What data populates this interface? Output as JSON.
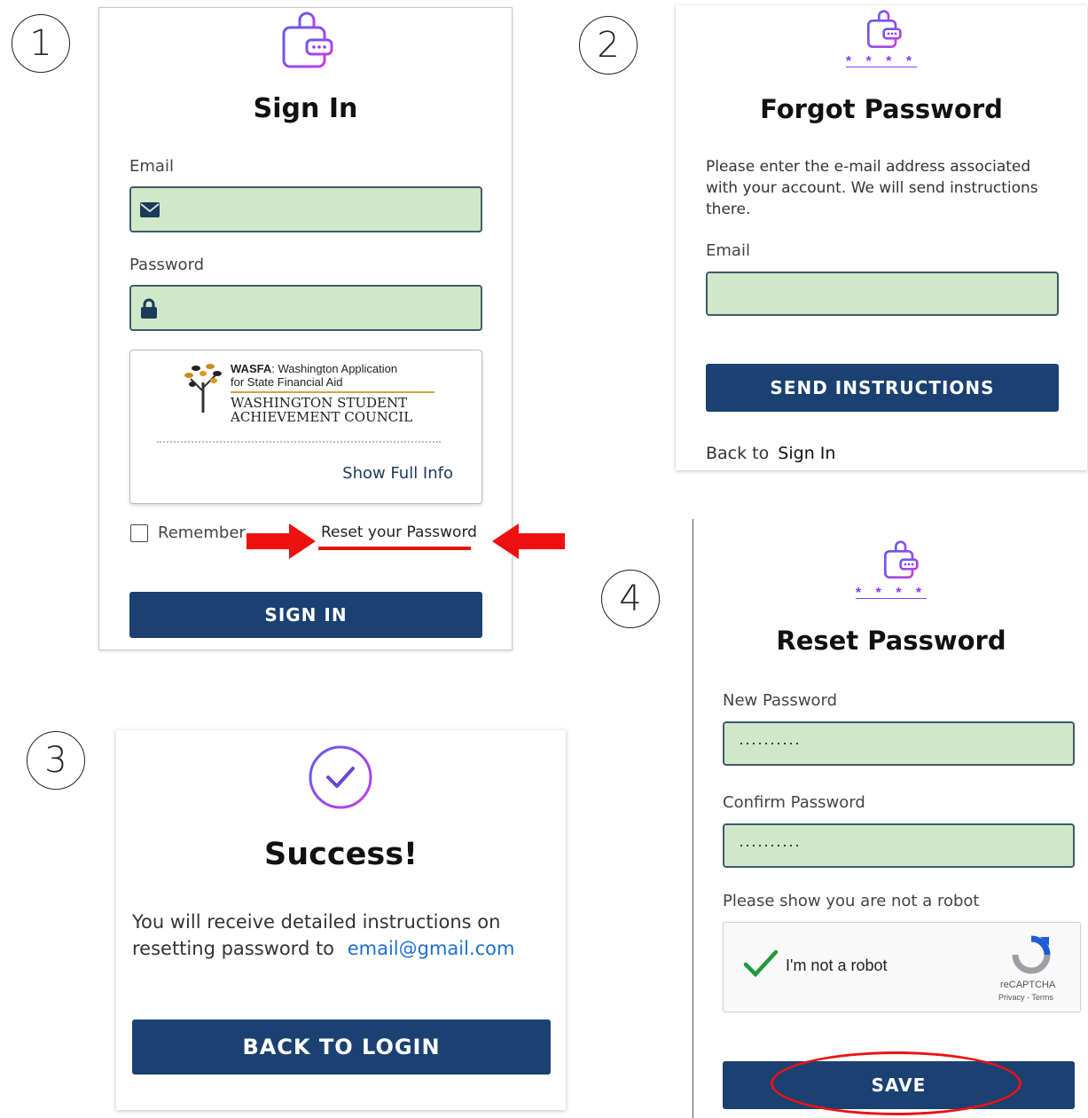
{
  "steps": [
    "1",
    "2",
    "3",
    "4"
  ],
  "colors": {
    "field_bg": "#cfe8c7",
    "button_bg": "#1b4172",
    "icon_purple": "#8a3df0",
    "annotation_red": "#ee1111",
    "link_blue": "#1f6fd1"
  },
  "signin": {
    "title": "Sign In",
    "email_label": "Email",
    "password_label": "Password",
    "info_box": {
      "wasfa_bold": "WASFA",
      "wasfa_rest": ": Washington Application",
      "wasfa_line2": "for State Financial Aid",
      "council_line1": "WASHINGTON STUDENT",
      "council_line2": "ACHIEVEMENT COUNCIL",
      "show_full_info": "Show Full Info"
    },
    "remember_label": "Remember",
    "reset_link": "Reset your Password",
    "button": "SIGN IN"
  },
  "forgot": {
    "stars": "* * * *",
    "title": "Forgot Password",
    "description": "Please enter the e-mail address associated with your account. We will send instructions there.",
    "email_label": "Email",
    "button": "SEND INSTRUCTIONS",
    "back_prefix": "Back to",
    "back_link": "Sign In"
  },
  "success": {
    "title": "Success!",
    "line1": "You will receive detailed instructions on",
    "line2": "resetting password to",
    "email": "email@gmail.com",
    "button": "BACK TO LOGIN"
  },
  "reset": {
    "stars": "* * * *",
    "title": "Reset Password",
    "new_label": "New Password",
    "new_value": "··········",
    "confirm_label": "Confirm Password",
    "confirm_value": "··········",
    "robot_prompt": "Please show you are not a robot",
    "captcha_label": "I'm not a robot",
    "captcha_brand": "reCAPTCHA",
    "captcha_links": "Privacy - Terms",
    "button": "SAVE"
  }
}
